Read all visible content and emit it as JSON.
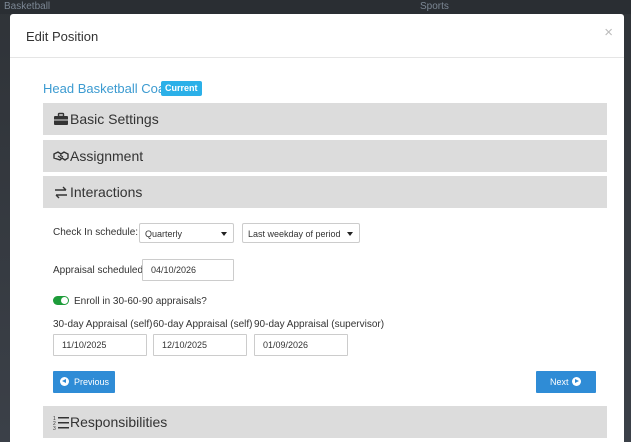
{
  "background": {
    "left_text": "Basketball",
    "right_text": "Sports"
  },
  "modal": {
    "title": "Edit Position",
    "close_glyph": "×"
  },
  "position": {
    "title": "Head Basketball Coach",
    "badge": "Current"
  },
  "sections": {
    "basic": {
      "label": "Basic Settings",
      "icon": "briefcase-icon"
    },
    "assignment": {
      "label": "Assignment",
      "icon": "handshake-icon"
    },
    "interactions": {
      "label": "Interactions",
      "icon": "exchange-icon"
    },
    "responsibilities": {
      "label": "Responsibilities",
      "icon": "list-ol-icon"
    }
  },
  "interactions": {
    "checkin_label": "Check In schedule:",
    "checkin_value": "Quarterly",
    "period_value": "Last weekday of period",
    "appraisal_label": "Appraisal scheduled:",
    "appraisal_value": "04/10/2026",
    "enroll_label": "Enroll in 30-60-90 appraisals?",
    "enroll_on": true,
    "appraisals": [
      {
        "label": "30-day Appraisal (self)",
        "value": "11/10/2025"
      },
      {
        "label": "60-day Appraisal (self)",
        "value": "12/10/2025"
      },
      {
        "label": "90-day Appraisal (supervisor)",
        "value": "01/09/2026"
      }
    ]
  },
  "buttons": {
    "previous": "Previous",
    "next": "Next"
  },
  "colors": {
    "primary": "#2f8cd6",
    "badge": "#2bb0e8",
    "link": "#3c9bd1",
    "toggle": "#1e9c3a",
    "section_bg": "#dcdcdc"
  }
}
